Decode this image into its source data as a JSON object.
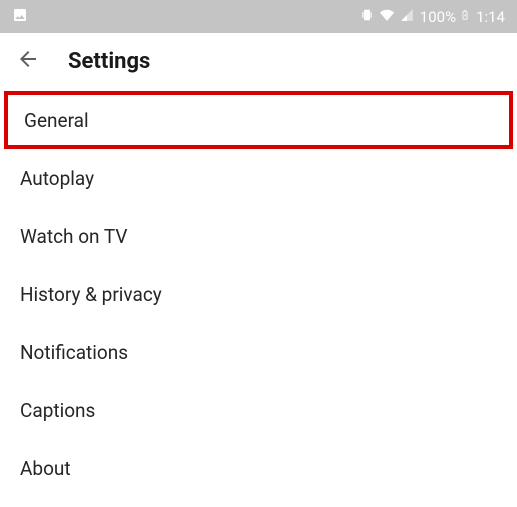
{
  "status_bar": {
    "battery_percent": "100%",
    "time": "1:14"
  },
  "header": {
    "title": "Settings"
  },
  "settings": {
    "items": [
      {
        "label": "General",
        "highlighted": true
      },
      {
        "label": "Autoplay",
        "highlighted": false
      },
      {
        "label": "Watch on TV",
        "highlighted": false
      },
      {
        "label": "History & privacy",
        "highlighted": false
      },
      {
        "label": "Notifications",
        "highlighted": false
      },
      {
        "label": "Captions",
        "highlighted": false
      },
      {
        "label": "About",
        "highlighted": false
      }
    ]
  }
}
